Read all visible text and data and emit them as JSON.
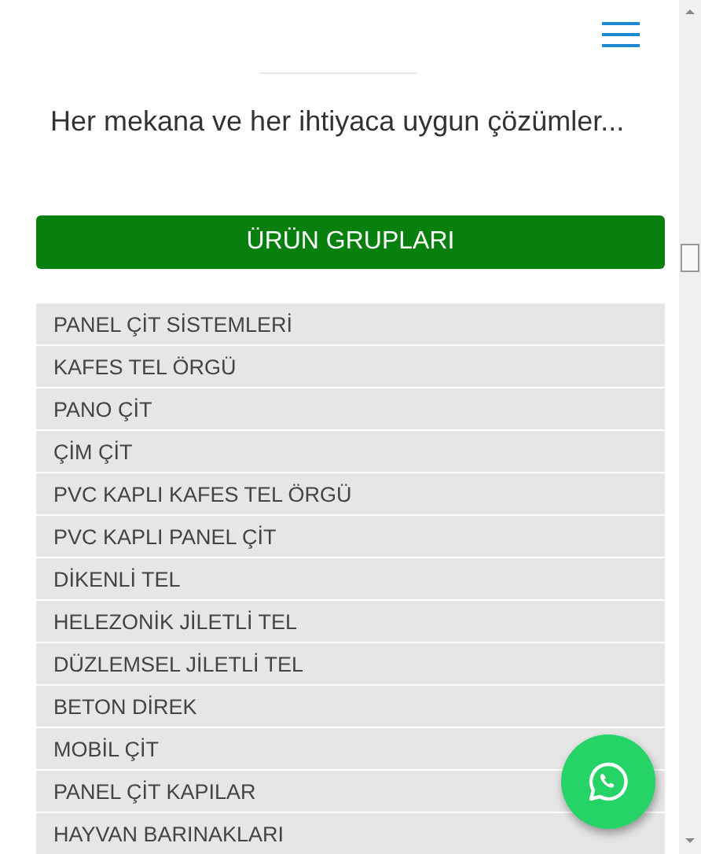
{
  "tagline": "Her mekana ve her ihtiyaca uygun çözümler...",
  "section_button": "ÜRÜN GRUPLARI",
  "categories": [
    "PANEL ÇİT SİSTEMLERİ",
    "KAFES TEL ÖRGÜ",
    "PANO ÇİT",
    "ÇİM ÇİT",
    "PVC KAPLI KAFES TEL ÖRGÜ",
    "PVC KAPLI PANEL ÇİT",
    "DİKENLİ TEL",
    "HELEZONİK JİLETLİ TEL",
    "DÜZLEMSEL JİLETLİ TEL",
    "BETON DİREK",
    "MOBİL ÇİT",
    "PANEL ÇİT KAPILAR",
    "HAYVAN BARINAKLARI"
  ]
}
